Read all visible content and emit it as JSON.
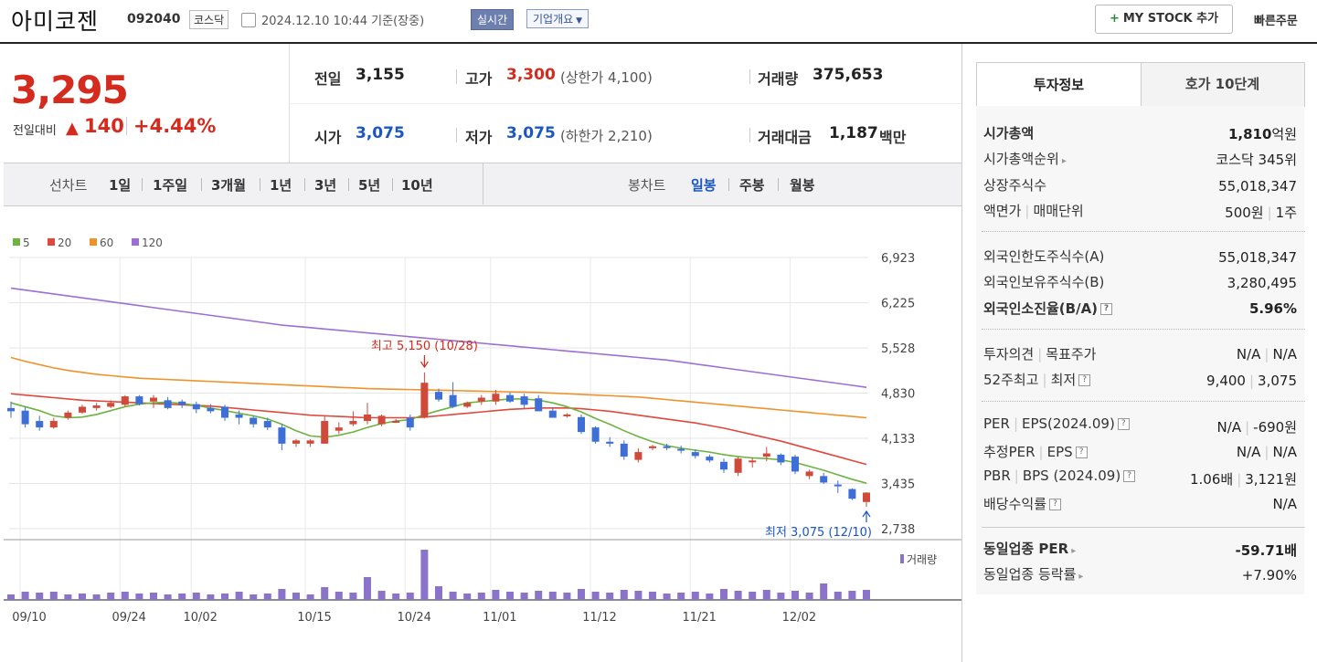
{
  "header": {
    "stock_name": "아미코젠",
    "stock_code": "092040",
    "market": "코스닥",
    "datetime": "2024.12.10 10:44  기준(장중)",
    "realtime_btn": "실시간",
    "overview_btn": "기업개요",
    "mystock_btn": "MY STOCK 추가",
    "quick_order": "빠른주문"
  },
  "price": {
    "current": "3,295",
    "change_label": "전일대비",
    "change": "140",
    "change_pct": "+4.44%"
  },
  "quote": {
    "prev_label": "전일",
    "prev": "3,155",
    "high_label": "고가",
    "high": "3,300",
    "upper_limit": "(상한가 4,100)",
    "volume_label": "거래량",
    "volume": "375,653",
    "open_label": "시가",
    "open": "3,075",
    "low_label": "저가",
    "low": "3,075",
    "lower_limit": "(하한가 2,210)",
    "amount_label": "거래대금",
    "amount": "1,187",
    "amount_unit": "백만"
  },
  "periods": {
    "line_label": "선차트",
    "line_items": [
      "1일",
      "1주일",
      "3개월",
      "1년",
      "3년",
      "5년",
      "10년"
    ],
    "candle_label": "봉차트",
    "candle_items": [
      "일봉",
      "주봉",
      "월봉"
    ],
    "selected_candle": "일봉"
  },
  "chart_data": {
    "type": "candlestick",
    "legend": [
      {
        "name": "5",
        "color": "#6cb33f"
      },
      {
        "name": "20",
        "color": "#e0473d"
      },
      {
        "name": "60",
        "color": "#f0922b"
      },
      {
        "name": "120",
        "color": "#9d6fd6"
      }
    ],
    "y_ticks": [
      "6,923",
      "6,225",
      "5,528",
      "4,830",
      "4,133",
      "3,435",
      "2,738"
    ],
    "x_ticks": [
      "09/10",
      "09/24",
      "10/02",
      "10/15",
      "10/24",
      "11/01",
      "11/12",
      "11/21",
      "12/02"
    ],
    "ylim": [
      2738,
      6923
    ],
    "max_annotation": "최고 5,150 (10/28)",
    "min_annotation": "최저 3,075 (12/10)",
    "volume_label": "거래량",
    "colors": {
      "up": "#d04a3a",
      "down": "#3d6fd6",
      "volume": "#8b73c9"
    },
    "candles": [
      {
        "o": 4600,
        "h": 4700,
        "l": 4450,
        "c": 4550
      },
      {
        "o": 4560,
        "h": 4620,
        "l": 4300,
        "c": 4350
      },
      {
        "o": 4400,
        "h": 4480,
        "l": 4250,
        "c": 4300
      },
      {
        "o": 4300,
        "h": 4450,
        "l": 4280,
        "c": 4400
      },
      {
        "o": 4450,
        "h": 4560,
        "l": 4420,
        "c": 4530
      },
      {
        "o": 4530,
        "h": 4650,
        "l": 4510,
        "c": 4620
      },
      {
        "o": 4600,
        "h": 4680,
        "l": 4560,
        "c": 4640
      },
      {
        "o": 4620,
        "h": 4720,
        "l": 4600,
        "c": 4680
      },
      {
        "o": 4650,
        "h": 4800,
        "l": 4620,
        "c": 4780
      },
      {
        "o": 4780,
        "h": 4800,
        "l": 4640,
        "c": 4660
      },
      {
        "o": 4700,
        "h": 4800,
        "l": 4600,
        "c": 4760
      },
      {
        "o": 4720,
        "h": 4770,
        "l": 4580,
        "c": 4600
      },
      {
        "o": 4700,
        "h": 4730,
        "l": 4600,
        "c": 4650
      },
      {
        "o": 4660,
        "h": 4700,
        "l": 4520,
        "c": 4580
      },
      {
        "o": 4600,
        "h": 4660,
        "l": 4520,
        "c": 4550
      },
      {
        "o": 4620,
        "h": 4650,
        "l": 4400,
        "c": 4450
      },
      {
        "o": 4500,
        "h": 4560,
        "l": 4350,
        "c": 4450
      },
      {
        "o": 4450,
        "h": 4480,
        "l": 4300,
        "c": 4350
      },
      {
        "o": 4400,
        "h": 4450,
        "l": 4260,
        "c": 4300
      },
      {
        "o": 4300,
        "h": 4350,
        "l": 3950,
        "c": 4050
      },
      {
        "o": 4050,
        "h": 4120,
        "l": 4000,
        "c": 4100
      },
      {
        "o": 4050,
        "h": 4120,
        "l": 4000,
        "c": 4100
      },
      {
        "o": 4050,
        "h": 4480,
        "l": 4050,
        "c": 4400
      },
      {
        "o": 4250,
        "h": 4380,
        "l": 4200,
        "c": 4300
      },
      {
        "o": 4350,
        "h": 4550,
        "l": 4320,
        "c": 4400
      },
      {
        "o": 4400,
        "h": 4680,
        "l": 4350,
        "c": 4500
      },
      {
        "o": 4350,
        "h": 4500,
        "l": 4320,
        "c": 4480
      },
      {
        "o": 4400,
        "h": 4430,
        "l": 4380,
        "c": 4400
      },
      {
        "o": 4450,
        "h": 4500,
        "l": 4250,
        "c": 4300
      },
      {
        "o": 4450,
        "h": 5150,
        "l": 4440,
        "c": 4990
      },
      {
        "o": 4850,
        "h": 4900,
        "l": 4700,
        "c": 4730
      },
      {
        "o": 4800,
        "h": 5000,
        "l": 4600,
        "c": 4620
      },
      {
        "o": 4620,
        "h": 4700,
        "l": 4600,
        "c": 4680
      },
      {
        "o": 4700,
        "h": 4800,
        "l": 4650,
        "c": 4760
      },
      {
        "o": 4700,
        "h": 4880,
        "l": 4650,
        "c": 4820
      },
      {
        "o": 4800,
        "h": 4840,
        "l": 4680,
        "c": 4700
      },
      {
        "o": 4780,
        "h": 4820,
        "l": 4600,
        "c": 4650
      },
      {
        "o": 4750,
        "h": 4800,
        "l": 4550,
        "c": 4550
      },
      {
        "o": 4560,
        "h": 4600,
        "l": 4450,
        "c": 4450
      },
      {
        "o": 4480,
        "h": 4520,
        "l": 4450,
        "c": 4500
      },
      {
        "o": 4460,
        "h": 4500,
        "l": 4200,
        "c": 4230
      },
      {
        "o": 4300,
        "h": 4320,
        "l": 4050,
        "c": 4080
      },
      {
        "o": 4080,
        "h": 4150,
        "l": 4000,
        "c": 4050
      },
      {
        "o": 4050,
        "h": 4100,
        "l": 3800,
        "c": 3850
      },
      {
        "o": 3800,
        "h": 3980,
        "l": 3760,
        "c": 3920
      },
      {
        "o": 3980,
        "h": 4030,
        "l": 3950,
        "c": 4010
      },
      {
        "o": 4010,
        "h": 4050,
        "l": 3950,
        "c": 3990
      },
      {
        "o": 3970,
        "h": 4020,
        "l": 3900,
        "c": 3950
      },
      {
        "o": 3920,
        "h": 3960,
        "l": 3820,
        "c": 3860
      },
      {
        "o": 3850,
        "h": 3880,
        "l": 3760,
        "c": 3790
      },
      {
        "o": 3770,
        "h": 3820,
        "l": 3600,
        "c": 3650
      },
      {
        "o": 3600,
        "h": 3850,
        "l": 3550,
        "c": 3820
      },
      {
        "o": 3780,
        "h": 3840,
        "l": 3680,
        "c": 3790
      },
      {
        "o": 3850,
        "h": 4000,
        "l": 3780,
        "c": 3900
      },
      {
        "o": 3880,
        "h": 3900,
        "l": 3720,
        "c": 3760
      },
      {
        "o": 3850,
        "h": 3880,
        "l": 3580,
        "c": 3620
      },
      {
        "o": 3550,
        "h": 3650,
        "l": 3500,
        "c": 3620
      },
      {
        "o": 3550,
        "h": 3600,
        "l": 3430,
        "c": 3450
      },
      {
        "o": 3420,
        "h": 3480,
        "l": 3290,
        "c": 3400
      },
      {
        "o": 3350,
        "h": 3360,
        "l": 3180,
        "c": 3200
      },
      {
        "o": 3150,
        "h": 3300,
        "l": 3075,
        "c": 3295
      }
    ],
    "ma5": [
      4680,
      4620,
      4560,
      4480,
      4450,
      4460,
      4500,
      4560,
      4620,
      4660,
      4680,
      4690,
      4670,
      4640,
      4600,
      4560,
      4520,
      4480,
      4430,
      4350,
      4250,
      4170,
      4150,
      4180,
      4230,
      4300,
      4360,
      4400,
      4420,
      4500,
      4560,
      4620,
      4680,
      4700,
      4720,
      4740,
      4740,
      4720,
      4680,
      4620,
      4540,
      4440,
      4350,
      4250,
      4160,
      4080,
      4020,
      3980,
      3950,
      3920,
      3880,
      3850,
      3830,
      3820,
      3800,
      3760,
      3700,
      3640,
      3570,
      3500,
      3440
    ],
    "ma20": [
      4820,
      4800,
      4780,
      4760,
      4740,
      4720,
      4710,
      4700,
      4690,
      4680,
      4670,
      4660,
      4650,
      4640,
      4630,
      4610,
      4590,
      4570,
      4550,
      4530,
      4510,
      4490,
      4480,
      4470,
      4460,
      4450,
      4450,
      4450,
      4450,
      4460,
      4480,
      4500,
      4520,
      4540,
      4560,
      4580,
      4590,
      4600,
      4600,
      4600,
      4590,
      4570,
      4550,
      4520,
      4490,
      4460,
      4430,
      4400,
      4370,
      4330,
      4290,
      4240,
      4190,
      4140,
      4090,
      4030,
      3970,
      3910,
      3850,
      3790,
      3730
    ],
    "ma60": [
      5380,
      5320,
      5270,
      5220,
      5180,
      5150,
      5120,
      5100,
      5080,
      5060,
      5050,
      5040,
      5030,
      5020,
      5010,
      5000,
      4990,
      4980,
      4970,
      4960,
      4950,
      4940,
      4930,
      4920,
      4910,
      4900,
      4895,
      4890,
      4885,
      4880,
      4875,
      4870,
      4865,
      4860,
      4855,
      4850,
      4845,
      4840,
      4830,
      4820,
      4810,
      4800,
      4790,
      4780,
      4770,
      4750,
      4730,
      4710,
      4690,
      4670,
      4650,
      4630,
      4610,
      4590,
      4570,
      4550,
      4530,
      4510,
      4490,
      4470,
      4450
    ],
    "ma120": [
      6450,
      6420,
      6390,
      6360,
      6330,
      6300,
      6270,
      6240,
      6210,
      6180,
      6150,
      6120,
      6090,
      6060,
      6030,
      6000,
      5970,
      5940,
      5910,
      5880,
      5860,
      5840,
      5820,
      5800,
      5780,
      5760,
      5740,
      5720,
      5700,
      5680,
      5660,
      5640,
      5620,
      5600,
      5580,
      5560,
      5540,
      5520,
      5500,
      5480,
      5460,
      5440,
      5420,
      5400,
      5380,
      5360,
      5340,
      5310,
      5280,
      5250,
      5220,
      5190,
      5160,
      5130,
      5100,
      5070,
      5040,
      5010,
      4980,
      4950,
      4920
    ],
    "volume": [
      6,
      9,
      8,
      9,
      6,
      7,
      6,
      8,
      9,
      7,
      8,
      6,
      7,
      8,
      6,
      7,
      9,
      6,
      7,
      12,
      8,
      6,
      14,
      9,
      8,
      25,
      10,
      7,
      8,
      55,
      15,
      9,
      7,
      8,
      11,
      9,
      8,
      10,
      9,
      8,
      12,
      9,
      8,
      11,
      10,
      9,
      7,
      8,
      9,
      7,
      12,
      10,
      9,
      11,
      8,
      10,
      8,
      18,
      9,
      10,
      11
    ],
    "up_flags": [
      0,
      0,
      0,
      1,
      1,
      1,
      1,
      1,
      1,
      0,
      1,
      0,
      0,
      0,
      0,
      0,
      0,
      0,
      0,
      0,
      1,
      1,
      1,
      1,
      1,
      1,
      1,
      0,
      0,
      1,
      0,
      0,
      1,
      1,
      1,
      0,
      0,
      0,
      0,
      1,
      0,
      0,
      0,
      0,
      1,
      1,
      0,
      0,
      0,
      0,
      0,
      1,
      1,
      1,
      0,
      0,
      1,
      0,
      0,
      0,
      1
    ]
  },
  "invest": {
    "tab_active": "투자정보",
    "tab_other": "호가 10단계",
    "market_cap_label": "시가총액",
    "market_cap": "1,810",
    "market_cap_unit": "억원",
    "cap_rank_label": "시가총액순위",
    "cap_rank": "코스닥 345위",
    "shares_label": "상장주식수",
    "shares": "55,018,347",
    "par_label": "액면가",
    "unit_label": "매매단위",
    "par": "500원",
    "unit": "1주",
    "foreign_limit_label": "외국인한도주식수(A)",
    "foreign_limit": "55,018,347",
    "foreign_hold_label": "외국인보유주식수(B)",
    "foreign_hold": "3,280,495",
    "foreign_ratio_label": "외국인소진율(B/A)",
    "foreign_ratio": "5.96%",
    "opinion_label": "투자의견",
    "target_label": "목표주가",
    "opinion": "N/A",
    "target": "N/A",
    "w52_high_label": "52주최고",
    "w52_low_label": "최저",
    "w52_high": "9,400",
    "w52_low": "3,075",
    "per_label": "PER",
    "eps_label": "EPS(2024.09)",
    "per": "N/A",
    "eps": "-690원",
    "est_per_label": "추정PER",
    "est_eps_label": "EPS",
    "est_per": "N/A",
    "est_eps": "N/A",
    "pbr_label": "PBR",
    "bps_label": "BPS (2024.09)",
    "pbr": "1.06배",
    "bps": "3,121원",
    "div_label": "배당수익률",
    "div": "N/A",
    "sector_per_label": "동일업종 PER",
    "sector_per": "-59.71배",
    "sector_rate_label": "동일업종 등락률",
    "sector_rate": "+7.90%"
  }
}
